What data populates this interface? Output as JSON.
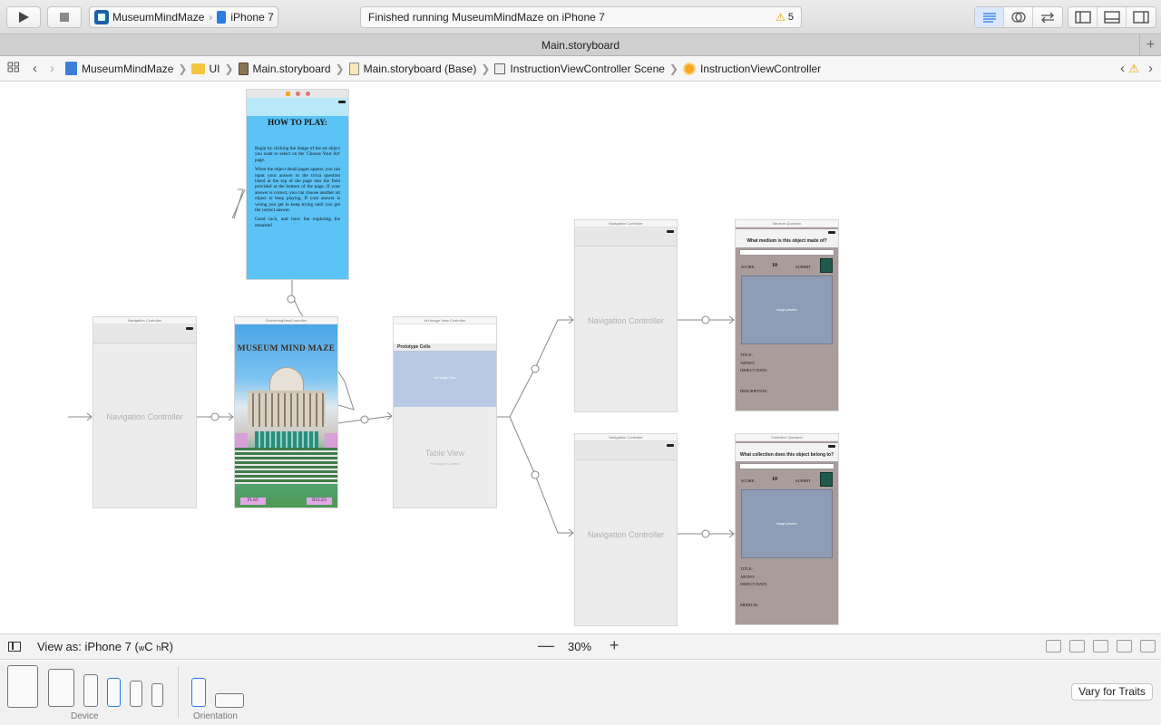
{
  "toolbar": {
    "scheme": "MuseumMindMaze",
    "device": "iPhone 7",
    "activity": "Finished running MuseumMindMaze on iPhone 7",
    "warning_count": "5"
  },
  "tab": {
    "title": "Main.storyboard"
  },
  "jumpbar": {
    "items": [
      "MuseumMindMaze",
      "UI",
      "Main.storyboard",
      "Main.storyboard (Base)",
      "InstructionViewController Scene",
      "InstructionViewController"
    ]
  },
  "canvas": {
    "nav1": {
      "header": "Navigation Controller",
      "label": "Navigation Controller"
    },
    "instructions": {
      "title": "HOW TO PLAY:",
      "p1": "Begin by clicking the image of the art object you want to select on the 'Choose Your Art' page.",
      "p2": "When the object detail pages appear, you can input your answer to the trivia question listed at the top of the page into the field provided at the bottom of the page. If your answer is correct, you can choose another art object to keep playing. If your answer is wrong you get to keep trying until you get the correct answer.",
      "p3": "Good luck, and have fun exploring the museum!"
    },
    "home": {
      "header": "SomethingViewController",
      "title": "MUSEUM MIND MAZE",
      "play": "PLAY",
      "rules": "RULES"
    },
    "table": {
      "header": "Art Image View Controller",
      "prototype": "Prototype Cells",
      "cell": "Art Image View",
      "tableview": "Table View",
      "tableview_sub": "Prototype Content"
    },
    "nav2": {
      "header": "Navigation Controller",
      "label": "Navigation Controller"
    },
    "nav3": {
      "header": "Navigation Controller",
      "label": "Navigation Controller"
    },
    "medium": {
      "header": "Medium Question",
      "question": "What medium is this object made of?",
      "score_label": "SCORE:",
      "score_value": "10",
      "submit": "SUBMIT",
      "image": "image preview",
      "meta": [
        "TITLE:",
        "ARTIST:",
        "OBJECT DATE:",
        "",
        "DESCRIPTION:"
      ]
    },
    "collection": {
      "header": "Collection Question",
      "question": "What collection does this object belong to?",
      "score_label": "SCORE:",
      "score_value": "10",
      "submit": "SUBMIT",
      "image": "image preview",
      "meta": [
        "TITLE:",
        "ARTIST:",
        "OBJECT DATE:",
        "",
        "MEDIUM:"
      ]
    }
  },
  "viewbar": {
    "view_as": "View as: iPhone 7 (",
    "traits_w": "w",
    "traits_wc": "C ",
    "traits_h": "h",
    "traits_hr": "R)",
    "zoom": "30%"
  },
  "devicebar": {
    "device_label": "Device",
    "orientation_label": "Orientation",
    "vary": "Vary for Traits"
  },
  "colors": {
    "accent": "#2c7be5",
    "warning": "#e6a100",
    "instructions_bg": "#5bc3f5",
    "quiz_bg": "#a99c9a"
  }
}
